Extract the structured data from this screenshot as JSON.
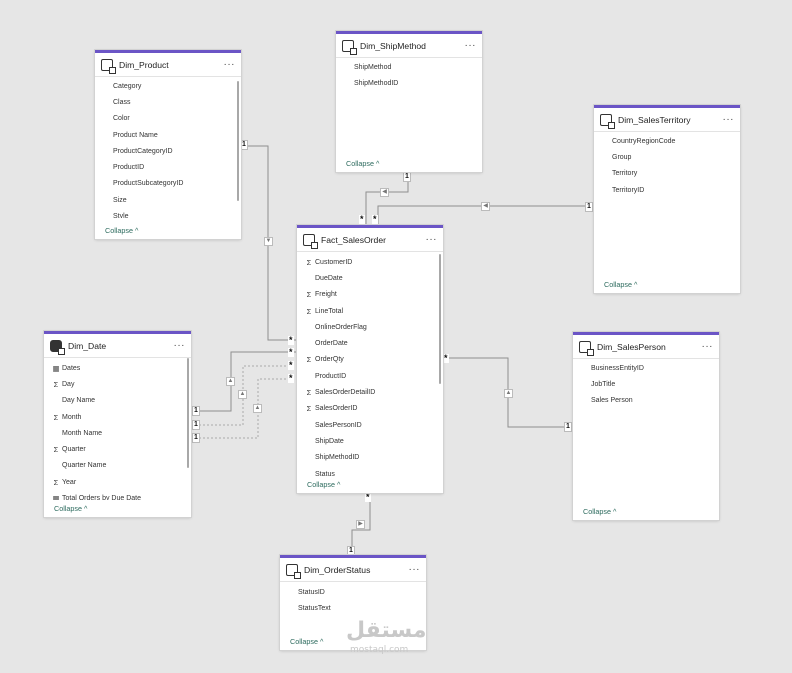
{
  "tables": {
    "dim_product": {
      "name": "Dim_Product",
      "fields": [
        {
          "name": "Category",
          "icon": ""
        },
        {
          "name": "Class",
          "icon": ""
        },
        {
          "name": "Color",
          "icon": ""
        },
        {
          "name": "Product Name",
          "icon": ""
        },
        {
          "name": "ProductCategoryID",
          "icon": ""
        },
        {
          "name": "ProductID",
          "icon": ""
        },
        {
          "name": "ProductSubcategoryID",
          "icon": ""
        },
        {
          "name": "Size",
          "icon": ""
        },
        {
          "name": "Style",
          "icon": ""
        }
      ],
      "collapse": "Collapse ^"
    },
    "dim_shipmethod": {
      "name": "Dim_ShipMethod",
      "fields": [
        {
          "name": "ShipMethod",
          "icon": ""
        },
        {
          "name": "ShipMethodID",
          "icon": ""
        }
      ],
      "collapse": "Collapse ^"
    },
    "dim_salesterritory": {
      "name": "Dim_SalesTerritory",
      "fields": [
        {
          "name": "CountryRegionCode",
          "icon": ""
        },
        {
          "name": "Group",
          "icon": ""
        },
        {
          "name": "Territory",
          "icon": ""
        },
        {
          "name": "TerritoryID",
          "icon": ""
        }
      ],
      "collapse": "Collapse ^"
    },
    "fact_salesorder": {
      "name": "Fact_SalesOrder",
      "fields": [
        {
          "name": "CustomerID",
          "icon": "Σ"
        },
        {
          "name": "DueDate",
          "icon": ""
        },
        {
          "name": "Freight",
          "icon": "Σ"
        },
        {
          "name": "LineTotal",
          "icon": "Σ"
        },
        {
          "name": "OnlineOrderFlag",
          "icon": ""
        },
        {
          "name": "OrderDate",
          "icon": ""
        },
        {
          "name": "OrderQty",
          "icon": "Σ"
        },
        {
          "name": "ProductID",
          "icon": ""
        },
        {
          "name": "SalesOrderDetailID",
          "icon": "Σ"
        },
        {
          "name": "SalesOrderID",
          "icon": "Σ"
        },
        {
          "name": "SalesPersonID",
          "icon": ""
        },
        {
          "name": "ShipDate",
          "icon": ""
        },
        {
          "name": "ShipMethodID",
          "icon": ""
        },
        {
          "name": "Status",
          "icon": ""
        }
      ],
      "collapse": "Collapse ^"
    },
    "dim_date": {
      "name": "Dim_Date",
      "fields": [
        {
          "name": "Dates",
          "icon": "▦"
        },
        {
          "name": "Day",
          "icon": "Σ"
        },
        {
          "name": "Day Name",
          "icon": ""
        },
        {
          "name": "Month",
          "icon": "Σ"
        },
        {
          "name": "Month Name",
          "icon": ""
        },
        {
          "name": "Quarter",
          "icon": "Σ"
        },
        {
          "name": "Quarter Name",
          "icon": ""
        },
        {
          "name": "Year",
          "icon": "Σ"
        },
        {
          "name": "Total Orders by Due Date",
          "icon": "▦"
        }
      ],
      "collapse": "Collapse ^"
    },
    "dim_salesperson": {
      "name": "Dim_SalesPerson",
      "fields": [
        {
          "name": "BusinessEntityID",
          "icon": ""
        },
        {
          "name": "JobTitle",
          "icon": ""
        },
        {
          "name": "Sales Person",
          "icon": ""
        }
      ],
      "collapse": "Collapse ^"
    },
    "dim_orderstatus": {
      "name": "Dim_OrderStatus",
      "fields": [
        {
          "name": "StatusID",
          "icon": ""
        },
        {
          "name": "StatusText",
          "icon": ""
        }
      ],
      "collapse": "Collapse ^"
    }
  },
  "menu_glyph": "···",
  "cardinality": {
    "one": "1",
    "many": "*"
  },
  "watermark": {
    "arabic": "مستقل",
    "latin": "mostaql.com"
  }
}
